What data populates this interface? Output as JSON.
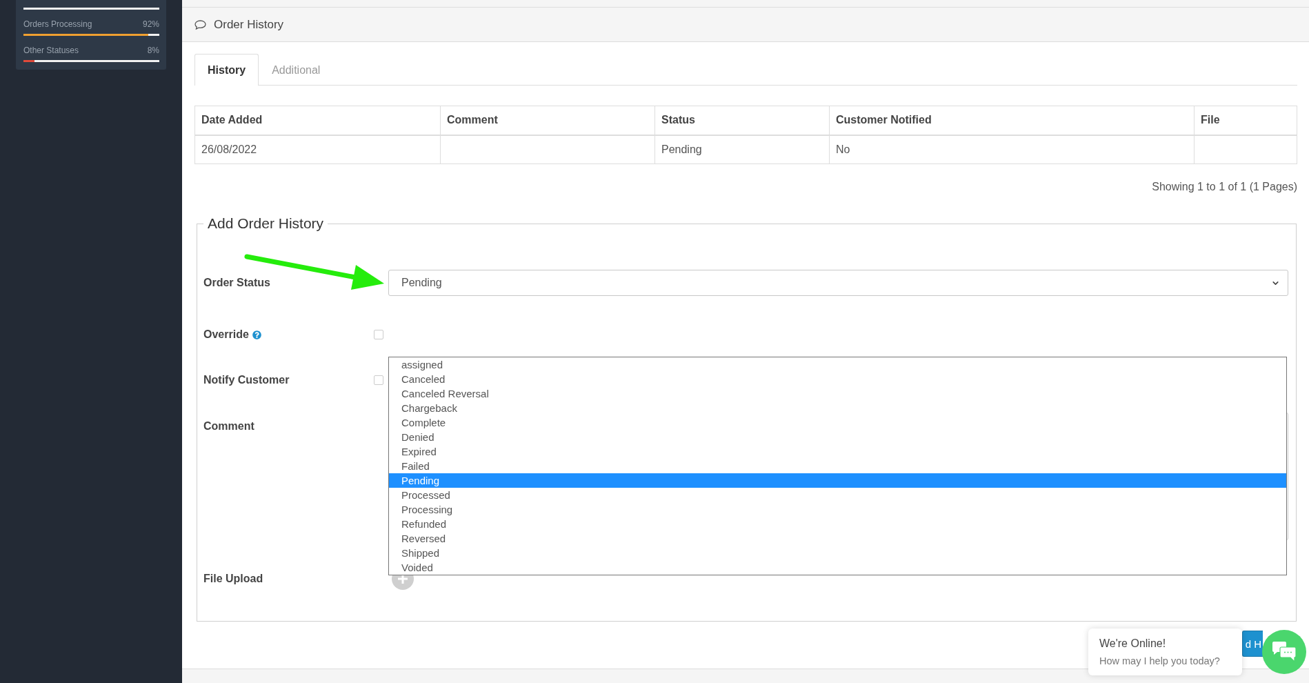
{
  "sidebar": {
    "stats": [
      {
        "level": 0
      },
      {
        "label": "Orders Processing",
        "reading": "92%",
        "level": 0.92,
        "color": "#f0a030"
      },
      {
        "label": "Other Statuses",
        "reading": "8%",
        "level": 0.08,
        "color": "#e04a3a"
      }
    ]
  },
  "panel": {
    "title": "Order History"
  },
  "tabs": [
    {
      "label": "History",
      "selected": true
    },
    {
      "label": "Additional",
      "selected": false
    }
  ],
  "table": {
    "columns": [
      "Date Added",
      "Comment",
      "Status",
      "Customer Notified",
      "File"
    ],
    "rows": [
      [
        "26/08/2022",
        null,
        "Pending",
        "No",
        null
      ]
    ]
  },
  "pagination": "Showing 1 to 1 of 1 (1 Pages)",
  "form": {
    "legend": "Add Order History",
    "fields": [
      {
        "kind": "select",
        "label": "Order Status",
        "value": "Pending",
        "options": [
          {
            "label": "assigned",
            "selected": false
          },
          {
            "label": "Canceled",
            "selected": false
          },
          {
            "label": "Canceled Reversal",
            "selected": false
          },
          {
            "label": "Chargeback",
            "selected": false
          },
          {
            "label": "Complete",
            "selected": false
          },
          {
            "label": "Denied",
            "selected": false
          },
          {
            "label": "Expired",
            "selected": false
          },
          {
            "label": "Failed",
            "selected": false
          },
          {
            "label": "Pending",
            "selected": true
          },
          {
            "label": "Processed",
            "selected": false
          },
          {
            "label": "Processing",
            "selected": false
          },
          {
            "label": "Refunded",
            "selected": false
          },
          {
            "label": "Reversed",
            "selected": false
          },
          {
            "label": "Shipped",
            "selected": false
          },
          {
            "label": "Voided",
            "selected": false
          }
        ]
      },
      {
        "kind": "checkbox",
        "label": "Override",
        "help": true,
        "checked": false
      },
      {
        "kind": "checkbox",
        "label": "Notify Customer",
        "checked": false
      },
      {
        "kind": "textarea",
        "label": "Comment"
      },
      {
        "kind": "upload",
        "label": "File Upload"
      }
    ]
  },
  "submit_button": {
    "label": "d H"
  },
  "chat": {
    "title": "We're Online!",
    "message": "How may I help you today?"
  }
}
